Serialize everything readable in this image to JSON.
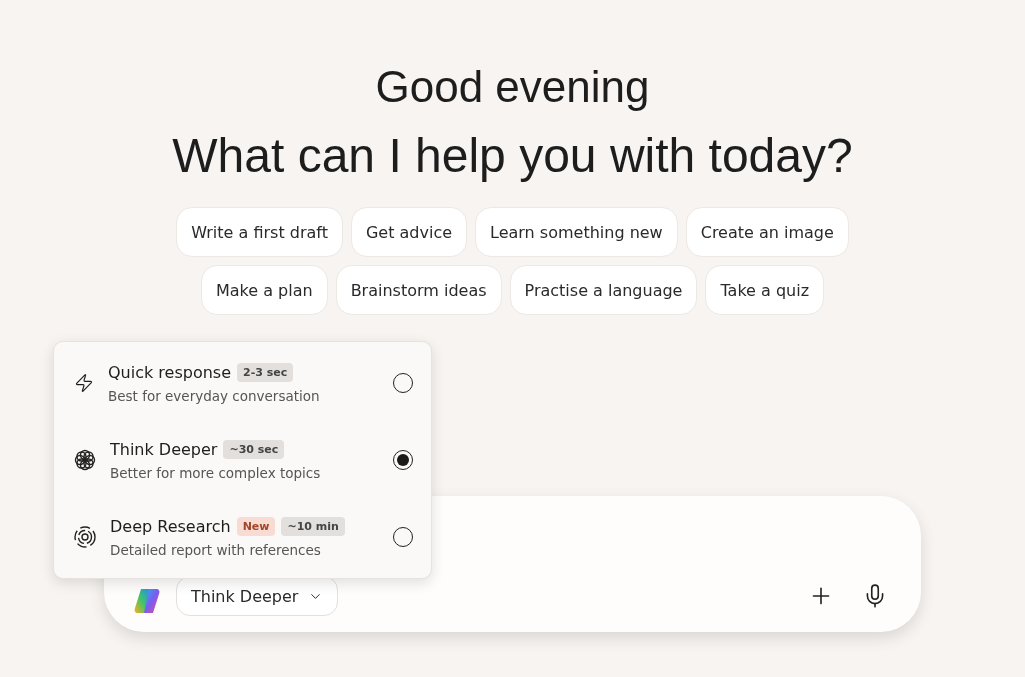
{
  "greeting": "Good evening",
  "headline": "What can I help you with today?",
  "suggestions": [
    [
      "Write a first draft",
      "Get advice",
      "Learn something new",
      "Create an image"
    ],
    [
      "Make a plan",
      "Brainstorm ideas",
      "Practise a language",
      "Take a quiz"
    ]
  ],
  "mode_menu": [
    {
      "kind": "quick",
      "title": "Quick response",
      "badges": [
        {
          "kind": "time",
          "text": "2-3 sec"
        }
      ],
      "description": "Best for everyday conversation",
      "selected": false
    },
    {
      "kind": "think",
      "title": "Think Deeper",
      "badges": [
        {
          "kind": "time",
          "text": "~30 sec"
        }
      ],
      "description": "Better for more complex topics",
      "selected": true
    },
    {
      "kind": "research",
      "title": "Deep Research",
      "badges": [
        {
          "kind": "new",
          "text": "New"
        },
        {
          "kind": "time",
          "text": "~10 min"
        }
      ],
      "description": "Detailed report with references",
      "selected": false
    }
  ],
  "composer": {
    "mode_button": "Think Deeper"
  }
}
